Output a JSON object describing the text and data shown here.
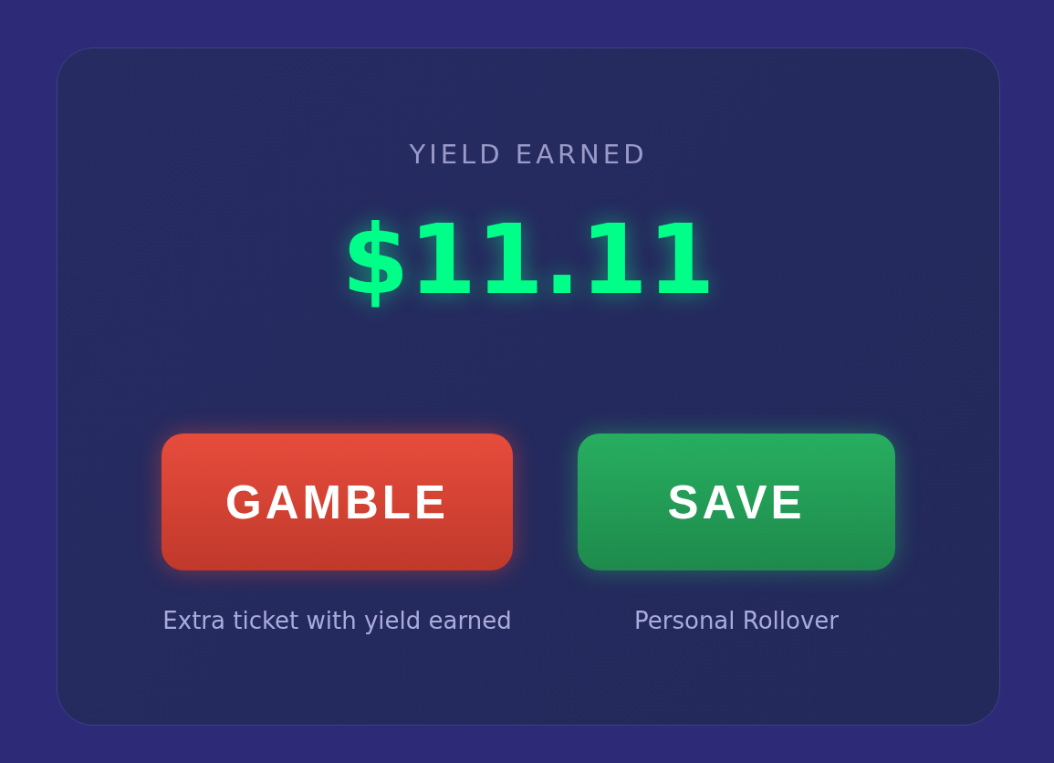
{
  "title": "YIELD EARNED",
  "amount": "$11.11",
  "options": [
    {
      "kind": "gamble",
      "label": "GAMBLE",
      "caption": "Extra ticket with yield earned"
    },
    {
      "kind": "save",
      "label": "SAVE",
      "caption": "Personal Rollover"
    }
  ]
}
